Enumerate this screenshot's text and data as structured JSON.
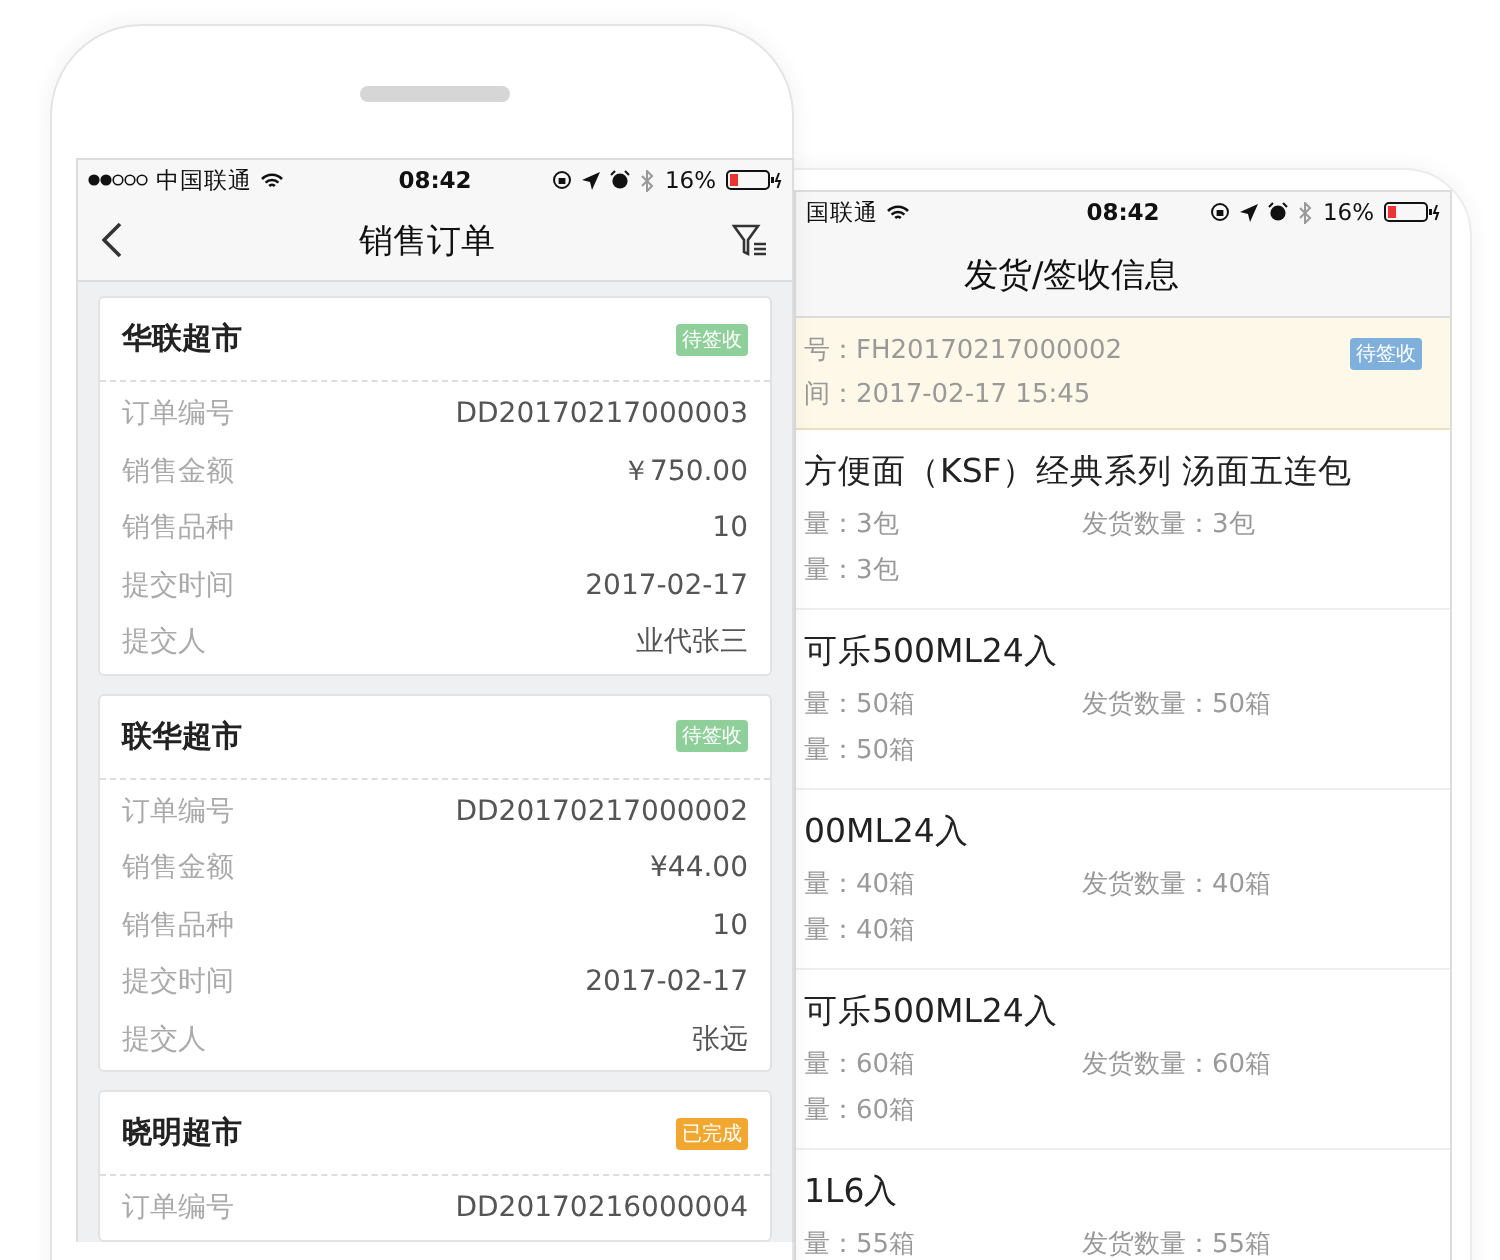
{
  "front_phone": {
    "status_bar": {
      "carrier": "中国联通",
      "time": "08:42",
      "battery": "16%"
    },
    "nav": {
      "title": "销售订单"
    },
    "orders": [
      {
        "store": "华联超市",
        "status": "待签收",
        "color": "#8fcf9a",
        "fields": [
          {
            "label": "订单编号",
            "value": "DD20170217000003"
          },
          {
            "label": "销售金额",
            "value": "￥750.00"
          },
          {
            "label": "销售品种",
            "value": "10"
          },
          {
            "label": "提交时间",
            "value": "2017-02-17"
          },
          {
            "label": "提交人",
            "value": "业代张三"
          }
        ]
      },
      {
        "store": "联华超市",
        "status": "待签收",
        "color": "#8fcf9a",
        "fields": [
          {
            "label": "订单编号",
            "value": "DD20170217000002"
          },
          {
            "label": "销售金额",
            "value": "¥44.00"
          },
          {
            "label": "销售品种",
            "value": "10"
          },
          {
            "label": "提交时间",
            "value": "2017-02-17"
          },
          {
            "label": "提交人",
            "value": "张远"
          }
        ]
      },
      {
        "store": "晓明超市",
        "status": "已完成",
        "color": "#f0a830",
        "fields": [
          {
            "label": "订单编号",
            "value": "DD20170216000004"
          }
        ]
      }
    ]
  },
  "back_phone": {
    "status_bar": {
      "carrier": "国联通",
      "time": "08:42",
      "battery": "16%"
    },
    "nav": {
      "title": "发货/签收信息"
    },
    "banner": {
      "lines": [
        "号：FH20170217000002",
        "间：2017-02-17 15:45"
      ],
      "status": "待签收"
    },
    "items": [
      {
        "name": "方便面（KSF）经典系列 汤面五连包",
        "line_1": [
          "量：3包",
          "发货数量：3包"
        ],
        "line_2": [
          "量：3包"
        ]
      },
      {
        "name": "可乐500ML24入",
        "line_1": [
          "量：50箱",
          "发货数量：50箱"
        ],
        "line_2": [
          "量：50箱"
        ]
      },
      {
        "name": "00ML24入",
        "line_1": [
          "量：40箱",
          "发货数量：40箱"
        ],
        "line_2": [
          "量：40箱"
        ]
      },
      {
        "name": "可乐500ML24入",
        "line_1": [
          "量：60箱",
          "发货数量：60箱"
        ],
        "line_2": [
          "量：60箱"
        ]
      },
      {
        "name": "1L6入",
        "line_1": [
          "量：55箱",
          "发货数量：55箱"
        ]
      }
    ]
  }
}
